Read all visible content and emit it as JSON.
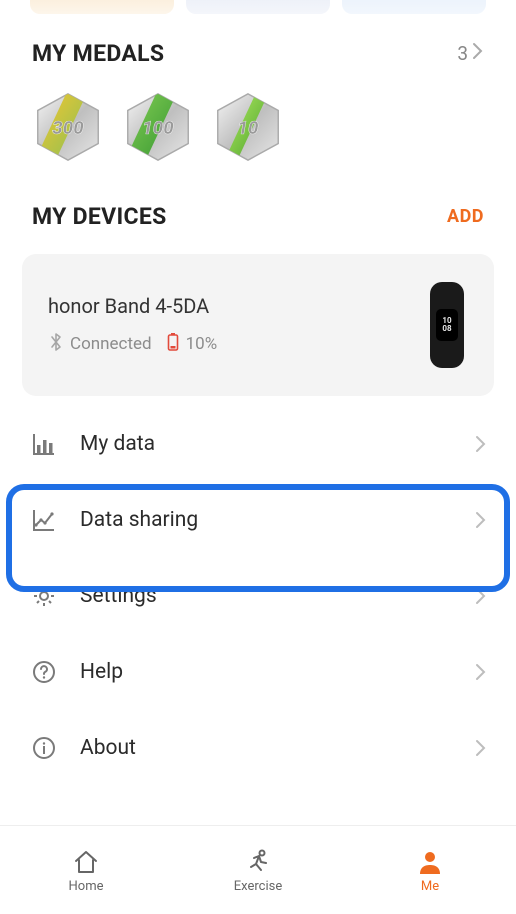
{
  "sections": {
    "medals": {
      "title": "MY MEDALS",
      "count": "3",
      "items": [
        {
          "value": "300"
        },
        {
          "value": "100"
        },
        {
          "value": "10"
        }
      ]
    },
    "devices": {
      "title": "MY DEVICES",
      "add_label": "ADD",
      "device": {
        "name": "honor Band 4-5DA",
        "status": "Connected",
        "battery": "10%",
        "screen_text": "10\n08"
      }
    }
  },
  "menu": {
    "my_data": "My data",
    "data_sharing": "Data sharing",
    "settings": "Settings",
    "help": "Help",
    "about": "About"
  },
  "nav": {
    "home": "Home",
    "exercise": "Exercise",
    "me": "Me"
  }
}
